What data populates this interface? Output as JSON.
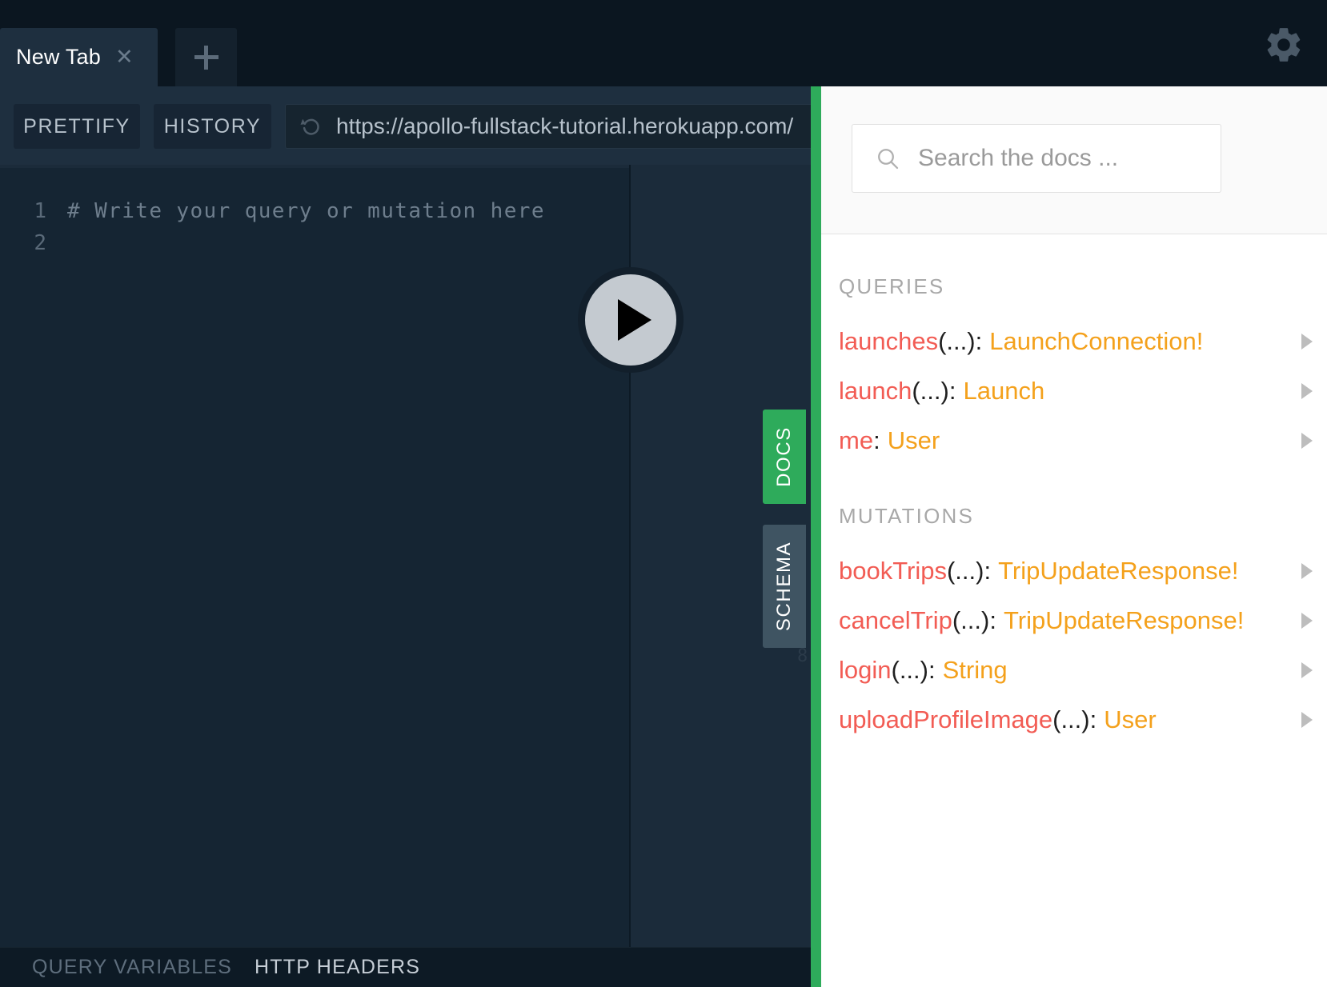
{
  "window": {
    "tabs": [
      {
        "label": "New Tab",
        "close_icon": "close-icon",
        "active": true
      }
    ],
    "new_tab_icon": "plus-icon",
    "settings_icon": "gear-icon"
  },
  "toolbar": {
    "prettify_label": "PRETTIFY",
    "history_label": "HISTORY",
    "reload_icon": "reload-icon",
    "url": "https://apollo-fullstack-tutorial.herokuapp.com/"
  },
  "editor": {
    "lines": [
      {
        "number": "1",
        "text": "# Write your query or mutation here"
      },
      {
        "number": "2",
        "text": ""
      }
    ],
    "run_icon": "play-icon",
    "faint_mark": "8"
  },
  "side_tabs": [
    {
      "label": "DOCS",
      "color": "#2eab5b",
      "active": true
    },
    {
      "label": "SCHEMA",
      "color": "#3f5462",
      "active": false
    }
  ],
  "bottom_bar": {
    "query_variables_label": "QUERY VARIABLES",
    "http_headers_label": "HTTP HEADERS"
  },
  "docs": {
    "search": {
      "placeholder": "Search the docs ...",
      "value": "",
      "icon": "search-icon"
    },
    "sections": [
      {
        "title": "QUERIES",
        "fields": [
          {
            "name": "launches",
            "args": "(...)",
            "colon": ":",
            "type": "LaunchConnection!",
            "arrow": "chevron-right-icon"
          },
          {
            "name": "launch",
            "args": "(...)",
            "colon": ":",
            "type": "Launch",
            "arrow": "chevron-right-icon"
          },
          {
            "name": "me",
            "args": "",
            "colon": ":",
            "type": "User",
            "arrow": "chevron-right-icon"
          }
        ]
      },
      {
        "title": "MUTATIONS",
        "fields": [
          {
            "name": "bookTrips",
            "args": "(...)",
            "colon": ":",
            "type": "TripUpdateResponse!",
            "arrow": "chevron-right-icon"
          },
          {
            "name": "cancelTrip",
            "args": "(...)",
            "colon": ":",
            "type": "TripUpdateResponse!",
            "arrow": "chevron-right-icon"
          },
          {
            "name": "login",
            "args": "(...)",
            "colon": ":",
            "type": "String",
            "arrow": "chevron-right-icon"
          },
          {
            "name": "uploadProfileImage",
            "args": "(...)",
            "colon": ":",
            "type": "User",
            "arrow": "chevron-right-icon"
          }
        ]
      }
    ]
  },
  "colors": {
    "accent_green": "#2eab5b",
    "field_red": "#f25c54",
    "type_orange": "#f4a11c",
    "editor_bg": "#152533",
    "chrome_bg": "#0b1620"
  }
}
